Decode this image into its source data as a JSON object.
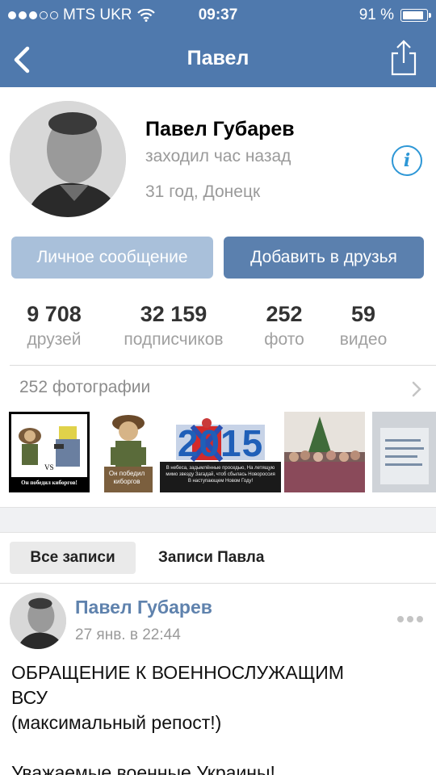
{
  "status_bar": {
    "carrier": "MTS UKR",
    "time": "09:37",
    "battery_text": "91 %",
    "battery_level": 0.91
  },
  "nav": {
    "title": "Павел",
    "back_icon": "chevron-left-icon",
    "share_icon": "share-icon"
  },
  "profile": {
    "name": "Павел Губарев",
    "last_seen": "заходил час назад",
    "age_city": "31 год, Донецк",
    "info_icon": "i"
  },
  "actions": {
    "message": "Личное сообщение",
    "add_friend": "Добавить в друзья"
  },
  "stats": [
    {
      "value": "9 708",
      "label": "друзей"
    },
    {
      "value": "32 159",
      "label": "подписчиков"
    },
    {
      "value": "252",
      "label": "фото"
    },
    {
      "value": "59",
      "label": "видео"
    }
  ],
  "photos": {
    "label": "252 фотографии",
    "thumbs": [
      {
        "caption": "Он победил киборгов!",
        "vs": "VS"
      },
      {
        "caption": "Он победил киборгов"
      },
      {
        "big_text": "2015",
        "caption": "В небеса, задымлённые проседью, На летящую мимо звезду Загадай, чтоб сбылась Новороссия В наступающем Новом Году!"
      },
      {
        "caption": ""
      },
      {
        "caption": ""
      }
    ]
  },
  "wall_tabs": {
    "all": "Все записи",
    "own": "Записи Павла"
  },
  "post": {
    "author": "Павел Губарев",
    "time": "27 янв. в 22:44",
    "lines": [
      "ОБРАЩЕНИЕ К ВОЕННОСЛУЖАЩИМ",
      "ВСУ",
      "(максимальный репост!)",
      "",
      "Уважаемые военные Украины!"
    ]
  },
  "colors": {
    "header": "#4f79ad",
    "link": "#5f82ad",
    "button_primary": "#5b80ae",
    "button_light": "#a9c0da",
    "info": "#2e97d6"
  }
}
